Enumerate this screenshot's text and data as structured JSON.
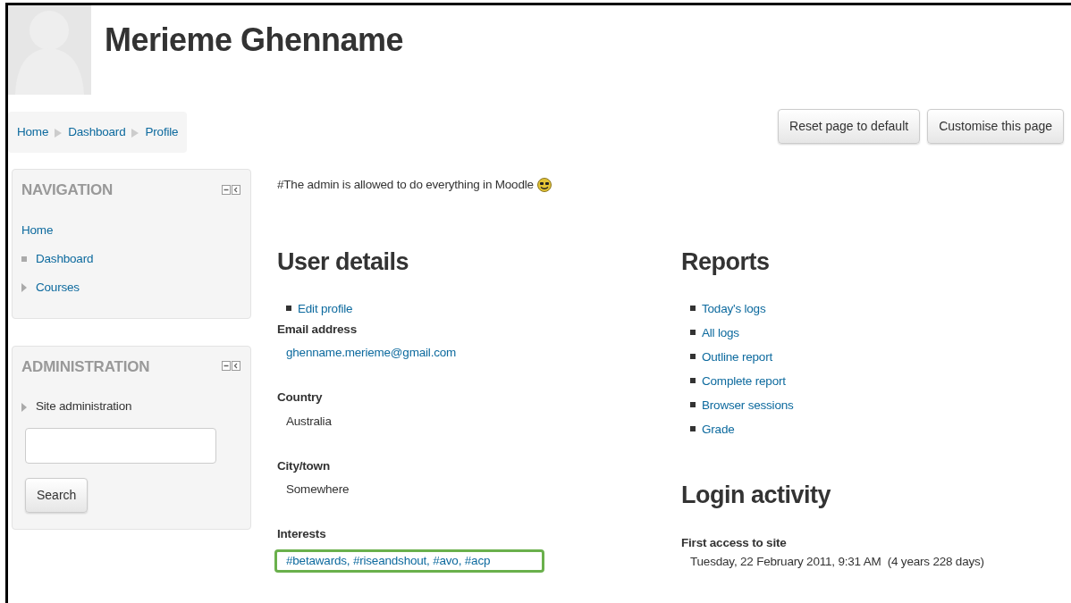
{
  "header": {
    "name": "Merieme Ghenname"
  },
  "breadcrumb": [
    {
      "label": "Home"
    },
    {
      "label": "Dashboard"
    },
    {
      "label": "Profile"
    }
  ],
  "page_buttons": [
    "Reset page to default",
    "Customise this page"
  ],
  "blocks": [
    {
      "title": "NAVIGATION",
      "items": [
        {
          "label": "Home",
          "kind": "root",
          "link": true
        },
        {
          "label": "Dashboard",
          "kind": "leaf",
          "link": true
        },
        {
          "label": "Courses",
          "kind": "branch",
          "link": true
        }
      ]
    },
    {
      "title": "ADMINISTRATION",
      "items": [
        {
          "label": "Site administration",
          "kind": "branch",
          "link": false
        }
      ],
      "search": {
        "button": "Search"
      }
    }
  ],
  "description": "#The admin is allowed to do everything in Moodle",
  "user_details": {
    "title": "User details",
    "links": [
      "Edit profile"
    ],
    "fields": [
      {
        "label": "Email address",
        "value": "ghenname.merieme@gmail.com",
        "link": true,
        "highlighted": false
      },
      {
        "label": "Country",
        "value": "Australia",
        "link": false,
        "highlighted": false
      },
      {
        "label": "City/town",
        "value": "Somewhere",
        "link": false,
        "highlighted": false
      },
      {
        "label": "Interests",
        "value": "#betawards, #riseandshout, #avo, #acp",
        "link": true,
        "highlighted": true
      }
    ]
  },
  "reports": {
    "title": "Reports",
    "links": [
      "Today's logs",
      "All logs",
      "Outline report",
      "Complete report",
      "Browser sessions",
      "Grade"
    ]
  },
  "login_activity": {
    "title": "Login activity",
    "fields": [
      {
        "label": "First access to site",
        "value": "Tuesday, 22 February 2011, 9:31 AM  (4 years 228 days)"
      }
    ]
  }
}
